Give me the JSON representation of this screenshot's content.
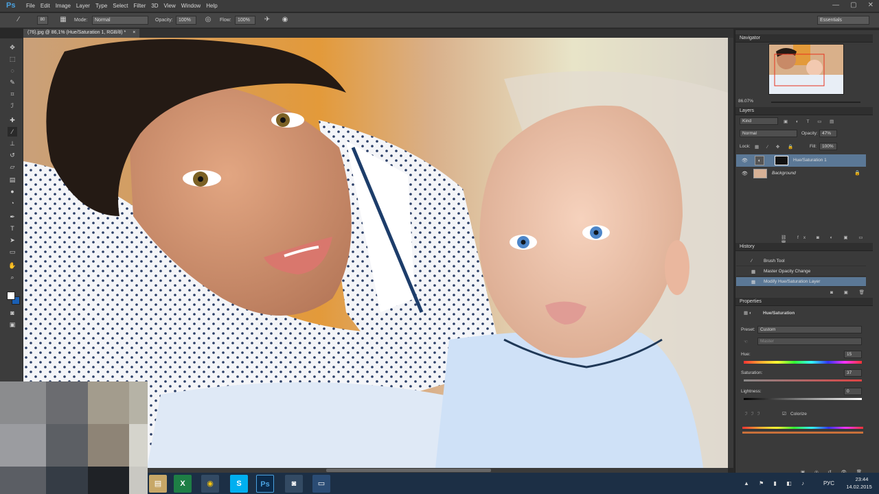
{
  "app": {
    "logo": "Ps"
  },
  "menu": [
    "File",
    "Edit",
    "Image",
    "Layer",
    "Type",
    "Select",
    "Filter",
    "3D",
    "View",
    "Window",
    "Help"
  ],
  "window_controls": {
    "minimize": "—",
    "maximize": "▢",
    "close": "✕"
  },
  "options": {
    "brush_size": "80",
    "mode_label": "Mode:",
    "mode_value": "Normal",
    "opacity_label": "Opacity:",
    "opacity_value": "100%",
    "flow_label": "Flow:",
    "flow_value": "100%",
    "workspace": "Essentials"
  },
  "document": {
    "tab_title": "(76).jpg @ 86,1% (Hue/Saturation 1, RGB/8) *",
    "close": "×"
  },
  "navigator": {
    "title": "Navigator",
    "zoom": "86.07%"
  },
  "layers": {
    "title": "Layers",
    "kind": "Kind",
    "blend_mode": "Normal",
    "opacity_label": "Opacity:",
    "opacity_value": "47%",
    "lock_label": "Lock:",
    "fill_label": "Fill:",
    "fill_value": "100%",
    "items": [
      {
        "name": "Hue/Saturation 1",
        "selected": true
      },
      {
        "name": "Background",
        "selected": false
      }
    ]
  },
  "history": {
    "title": "History",
    "items": [
      "Brush Tool",
      "Master Opacity Change",
      "Modify Hue/Saturation Layer"
    ]
  },
  "properties": {
    "title": "Properties",
    "adjustment": "Hue/Saturation",
    "preset_label": "Preset:",
    "preset_value": "Custom",
    "channel": "Master",
    "hue_label": "Hue:",
    "hue_value": "15",
    "saturation_label": "Saturation:",
    "saturation_value": "37",
    "lightness_label": "Lightness:",
    "lightness_value": "0",
    "colorize_label": "Colorize",
    "colorize_checked": true
  },
  "taskbar": {
    "lang": "РУС",
    "time": "23:44",
    "date": "14.02.2015",
    "apps": [
      "file-explorer",
      "excel",
      "chrome",
      "skype",
      "photoshop",
      "camera",
      "monitor"
    ]
  },
  "colors": {
    "accent": "#4aa2e0",
    "selection": "#5b7896",
    "taskbar": "#1c2f45"
  }
}
